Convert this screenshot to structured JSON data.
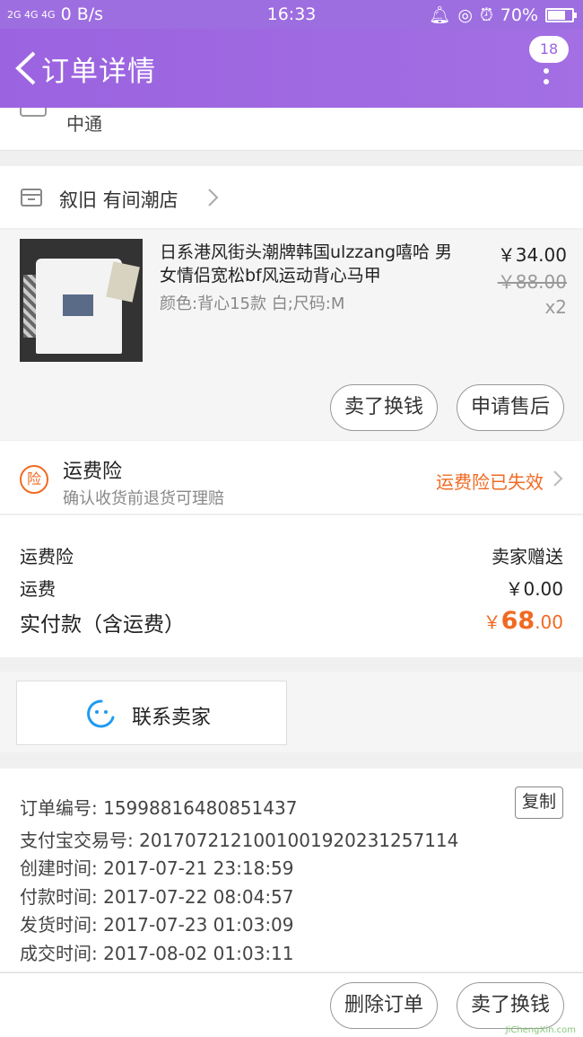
{
  "status_bar": {
    "network": "2G 4G 4G",
    "speed": "0 B/s",
    "time": "16:33",
    "battery": "70%"
  },
  "header": {
    "title": "订单详情",
    "badge": "18"
  },
  "logistics": {
    "carrier": "中通"
  },
  "shop": {
    "name": "叙旧  有间潮店"
  },
  "item": {
    "title": "日系港风街头潮牌韩国ulzzang嘻哈 男女情侣宽松bf风运动背心马甲",
    "spec": "颜色:背心15款 白;尺码:M",
    "price": "￥34.00",
    "original_price": "￥88.00",
    "quantity": "x2",
    "btn_resell": "卖了换钱",
    "btn_after_sale": "申请售后"
  },
  "insurance": {
    "badge": "险",
    "title": "运费险",
    "desc": "确认收货前退货可理赔",
    "status": "运费险已失效"
  },
  "costs": {
    "ins_label": "运费险",
    "ins_value": "卖家赠送",
    "ship_label": "运费",
    "ship_value": "￥0.00",
    "total_label": "实付款（含运费）",
    "total_currency": "￥",
    "total_int": "68",
    "total_dec": ".00"
  },
  "contact": {
    "label": "联系卖家"
  },
  "order_info": {
    "order_no": "订单编号: 15998816480851437",
    "copy": "复制",
    "alipay_no": "支付宝交易号: 2017072121001001920231257114",
    "created": "创建时间: 2017-07-21 23:18:59",
    "paid": "付款时间: 2017-07-22 08:04:57",
    "shipped": "发货时间: 2017-07-23 01:03:09",
    "completed": "成交时间: 2017-08-02 01:03:11"
  },
  "bottom_bar": {
    "delete_order": "删除订单",
    "resell": "卖了换钱"
  },
  "watermark": "JiChengXin.com",
  "colors": {
    "header": "#9b63e0",
    "accent": "#f06a22",
    "contact_icon": "#1e9bf0"
  }
}
